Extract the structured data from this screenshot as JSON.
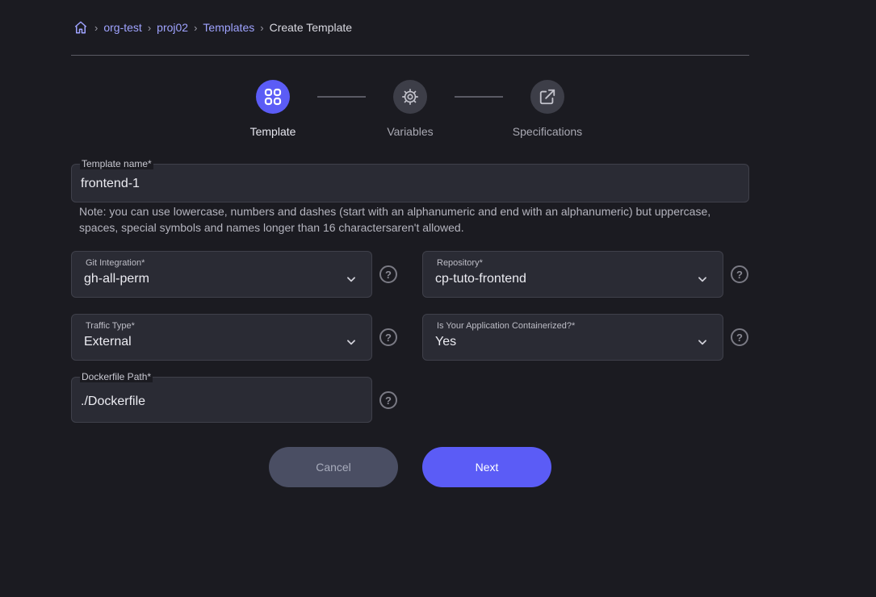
{
  "breadcrumb": {
    "home_icon": "home-icon",
    "items": [
      "org-test",
      "proj02",
      "Templates"
    ],
    "current": "Create Template"
  },
  "stepper": {
    "steps": [
      {
        "label": "Template",
        "icon": "grid-icon",
        "active": true
      },
      {
        "label": "Variables",
        "icon": "gear-icon",
        "active": false
      },
      {
        "label": "Specifications",
        "icon": "external-link-icon",
        "active": false
      }
    ]
  },
  "form": {
    "template_name": {
      "label": "Template name*",
      "value": "frontend-1"
    },
    "note": "Note: you can use lowercase, numbers and dashes (start with an alphanumeric and end with an alphanumeric) but uppercase, spaces, special symbols and names longer than 16 charactersaren't allowed.",
    "git_integration": {
      "label": "Git Integration*",
      "value": "gh-all-perm"
    },
    "repository": {
      "label": "Repository*",
      "value": "cp-tuto-frontend"
    },
    "traffic_type": {
      "label": "Traffic Type*",
      "value": "External"
    },
    "containerized": {
      "label": "Is Your Application Containerized?*",
      "value": "Yes"
    },
    "dockerfile_path": {
      "label": "Dockerfile Path*",
      "value": "./Dockerfile"
    }
  },
  "help_glyph": "?",
  "actions": {
    "cancel": "Cancel",
    "next": "Next"
  },
  "colors": {
    "accent": "#5b5cf6",
    "background": "#1b1b21",
    "link": "#9fa3ff"
  }
}
